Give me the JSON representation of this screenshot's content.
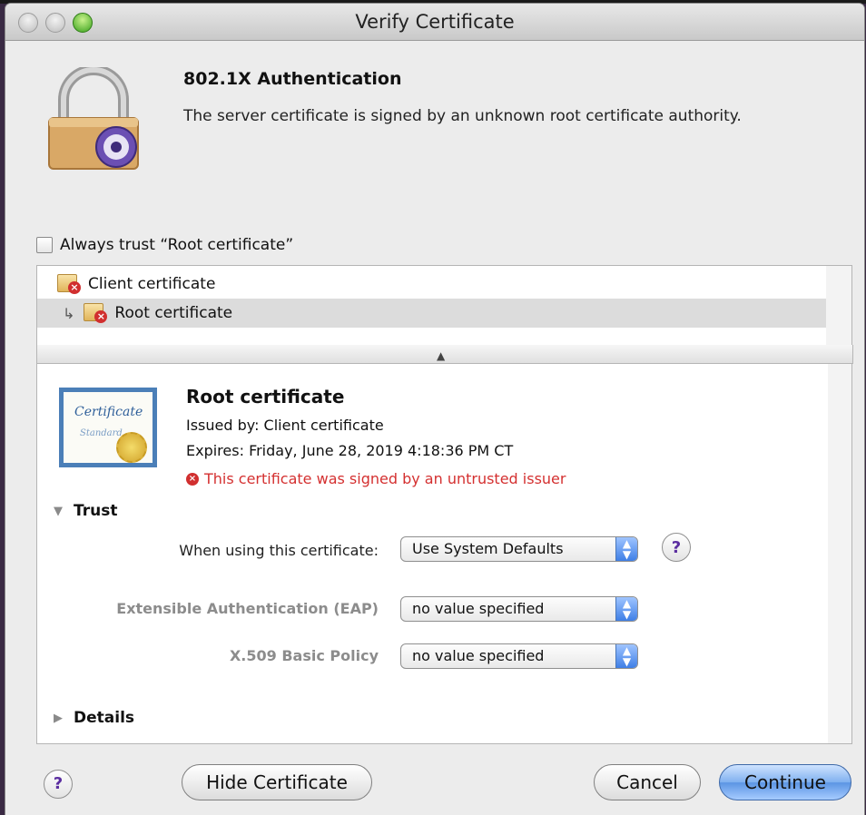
{
  "window": {
    "title": "Verify Certificate"
  },
  "header": {
    "title": "802.1X Authentication",
    "message": "The server certificate is signed by an unknown root certificate authority."
  },
  "always_trust": {
    "label": "Always trust “Root certificate”",
    "checked": false
  },
  "chain": {
    "items": [
      {
        "label": "Client certificate"
      },
      {
        "label": "Root certificate",
        "arrow": "↳"
      }
    ]
  },
  "details": {
    "cert_image": {
      "script_text": "Certificate",
      "sub_text": "Standard"
    },
    "name": "Root certificate",
    "issued_by": "Issued by: Client certificate",
    "expires": "Expires: Friday, June 28, 2019 4:18:36 PM CT",
    "warning": "This certificate was signed by an untrusted issuer",
    "trust_section": {
      "label": "Trust",
      "rows": [
        {
          "label": "When using this certificate:",
          "value": "Use System Defaults"
        },
        {
          "label": "Extensible Authentication (EAP)",
          "value": "no value specified"
        },
        {
          "label": "X.509 Basic Policy",
          "value": "no value specified"
        }
      ]
    },
    "details_section": {
      "label": "Details"
    }
  },
  "buttons": {
    "help": "?",
    "hide_certificate": "Hide Certificate",
    "cancel": "Cancel",
    "continue": "Continue"
  },
  "colors": {
    "warning_red": "#d43030",
    "default_button_blue": "#5b95e3",
    "zoom_green": "#38a11c"
  }
}
